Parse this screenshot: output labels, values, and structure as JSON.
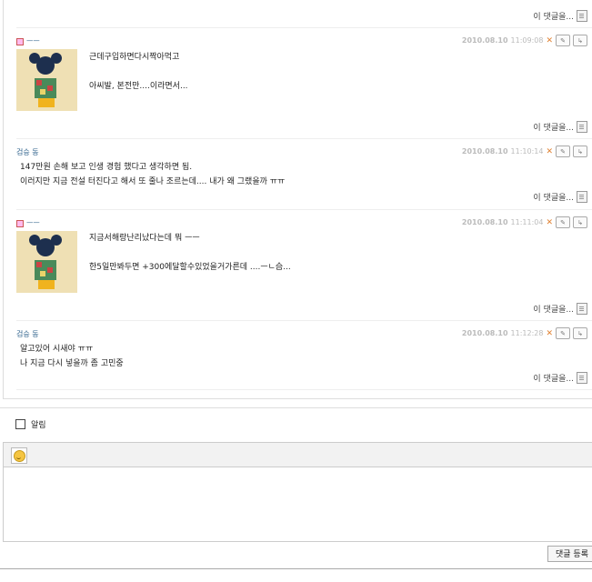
{
  "reply_link_label": "이 댓글을...",
  "comments": [
    {
      "author": "ㅡㅡ",
      "date": "2010.08.10",
      "time": "11:09:08",
      "lines": [
        "근데구입하면다시짝아먹고",
        "",
        "아씨발, 본전만....이라면서..."
      ],
      "has_thumb": true
    },
    {
      "author": "검승 동",
      "date": "2010.08.10",
      "time": "11:10:14",
      "lines": [
        "147만원 손해 보고 인생 경험 했다고 생각하면 됨.",
        "이러지만 지금 전설 터진다고 해서 또 줄나 조르는데.... 내가 왜 그랬을까 ㅠㅠ"
      ],
      "has_thumb": false
    },
    {
      "author": "ㅡㅡ",
      "date": "2010.08.10",
      "time": "11:11:04",
      "lines": [
        "지금서해랑난리났다는데 뭐 ㅡㅡ",
        "",
        "한5일만봐두면 +300에달할수있었을거가른데 ....ㅡㄴ슴..."
      ],
      "has_thumb": true
    },
    {
      "author": "검승 동",
      "date": "2010.08.10",
      "time": "11:12:28",
      "lines": [
        "알고있어 시새야 ㅠㅠ",
        "나 지금 다시 넣을까 좀 고민중"
      ],
      "has_thumb": false
    }
  ],
  "notify_label": "알림",
  "submit_label": "댓글 등록"
}
